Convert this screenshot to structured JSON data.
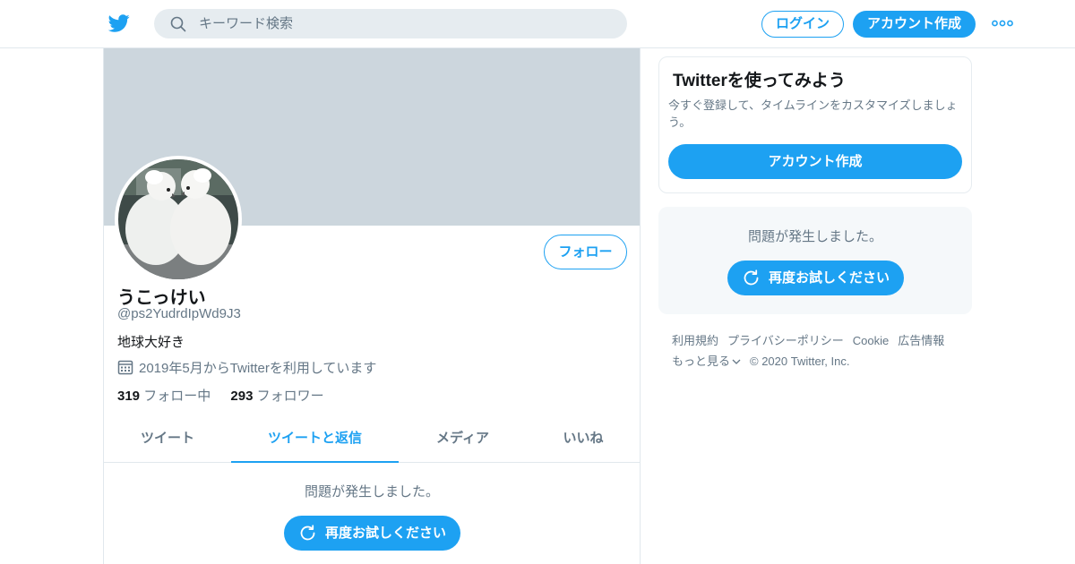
{
  "header": {
    "search_placeholder": "キーワード検索",
    "login_label": "ログイン",
    "signup_label": "アカウント作成"
  },
  "profile": {
    "display_name": "うこっけい",
    "handle": "@ps2YudrdIpWd9J3",
    "bio": "地球大好き",
    "joined": "2019年5月からTwitterを利用しています",
    "following_count": "319",
    "following_label": "フォロー中",
    "followers_count": "293",
    "followers_label": "フォロワー",
    "follow_button": "フォロー"
  },
  "tabs": [
    {
      "label": "ツイート",
      "active": false
    },
    {
      "label": "ツイートと返信",
      "active": true
    },
    {
      "label": "メディア",
      "active": false
    },
    {
      "label": "いいね",
      "active": false
    }
  ],
  "timeline_error": {
    "message": "問題が発生しました。",
    "retry_label": "再度お試しください"
  },
  "sidebar": {
    "signup_card": {
      "title": "Twitterを使ってみよう",
      "description": "今すぐ登録して、タイムラインをカスタマイズしましょう。",
      "button": "アカウント作成"
    },
    "error_card": {
      "message": "問題が発生しました。",
      "retry_label": "再度お試しください"
    },
    "footer": {
      "links": [
        "利用規約",
        "プライバシーポリシー",
        "Cookie",
        "広告情報"
      ],
      "more": "もっと見る",
      "copyright": "© 2020 Twitter, Inc."
    }
  },
  "colors": {
    "accent": "#1da1f2",
    "banner": "#ccd6dd",
    "muted_text": "#657786"
  }
}
